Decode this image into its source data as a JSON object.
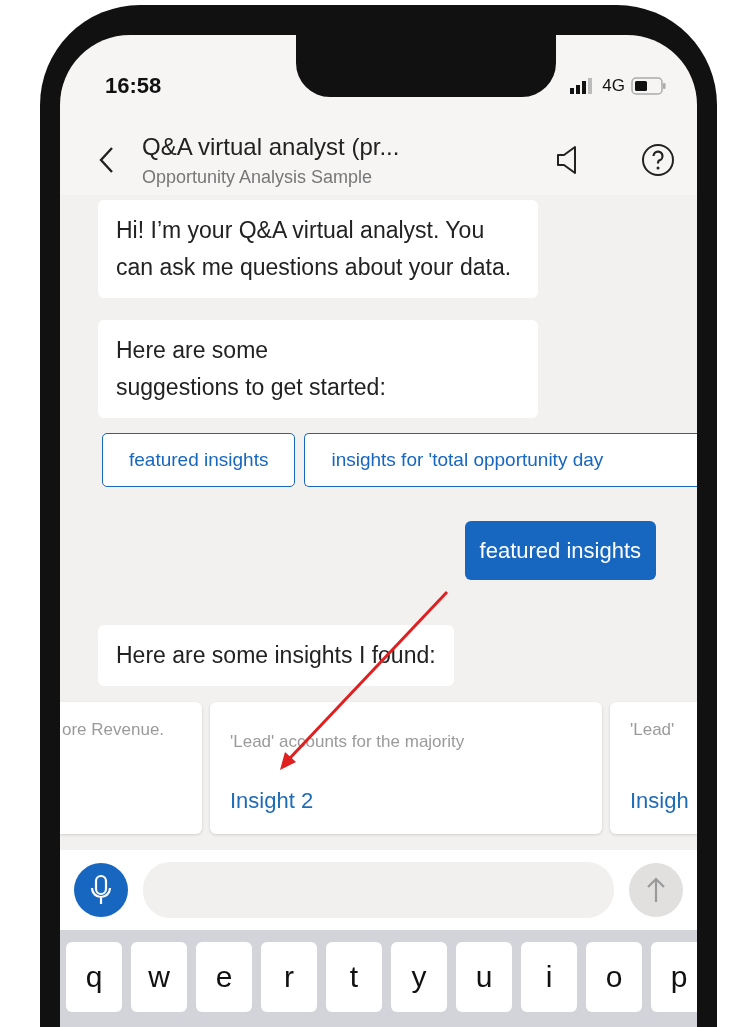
{
  "status_bar": {
    "time": "16:58",
    "network": "4G"
  },
  "header": {
    "title": "Q&A virtual analyst (pr...",
    "subtitle": "Opportunity Analysis Sample"
  },
  "messages": [
    {
      "kind": "bot",
      "text": "Hi! I’m your Q&A virtual analyst. You can ask me questions about your data."
    },
    {
      "kind": "bot",
      "text": "Here are some suggestions to get started:"
    },
    {
      "kind": "chips",
      "chips": [
        "featured insights",
        "insights for 'total opportunity day"
      ]
    },
    {
      "kind": "user",
      "text": "featured insights"
    },
    {
      "kind": "bot",
      "text": "Here are some insights I found:"
    },
    {
      "kind": "cards",
      "cards": [
        {
          "text": "ore Revenue."
        },
        {
          "text": "'Lead' accounts for the majority",
          "link": "Insight 2"
        },
        {
          "text": "'Lead'",
          "link": "Insigh"
        }
      ]
    }
  ],
  "keyboard": {
    "keys": [
      "q",
      "w",
      "e",
      "r",
      "t",
      "y",
      "u",
      "i",
      "o",
      "p"
    ]
  }
}
